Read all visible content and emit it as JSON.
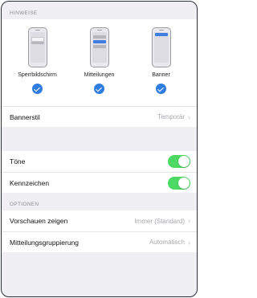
{
  "hinweise": {
    "header": "HINWEISE",
    "options": [
      {
        "label": "Sperrbildschirm",
        "icon": "lockscreen-preview-icon",
        "checked": true
      },
      {
        "label": "Mitteilungen",
        "icon": "notification-center-preview-icon",
        "checked": true
      },
      {
        "label": "Banner",
        "icon": "banner-preview-icon",
        "checked": true
      }
    ],
    "bannerstil_label": "Bannerstil",
    "bannerstil_value": "Temporär"
  },
  "toggles": {
    "toene_label": "Töne",
    "toene_on": true,
    "kennzeichen_label": "Kennzeichen",
    "kennzeichen_on": true
  },
  "optionen": {
    "header": "OPTIONEN",
    "vorschau_label": "Vorschauen zeigen",
    "vorschau_value": "Immer (Standard)",
    "gruppierung_label": "Mitteilungsgruppierung",
    "gruppierung_value": "Automatisch"
  },
  "colors": {
    "accent": "#2f7de1",
    "toggle_on": "#4cd964",
    "background": "#efeff4"
  }
}
